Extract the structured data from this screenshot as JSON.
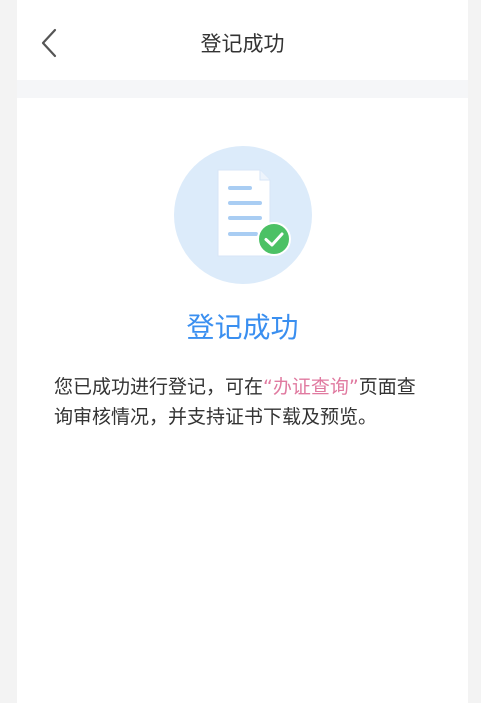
{
  "header": {
    "title": "登记成功"
  },
  "result": {
    "title": "登记成功",
    "message_prefix": "您已成功进行登记，可在",
    "message_link": "“办证查询”",
    "message_suffix": "页面查询审核情况，并支持证书下载及预览。"
  },
  "colors": {
    "accent": "#3a8ff0",
    "link": "#e07aa0",
    "success": "#4cc165",
    "icon_circle": "#dcebfa"
  },
  "icons": {
    "back": "chevron-left-icon",
    "document": "document-icon",
    "check": "check-circle-icon"
  }
}
